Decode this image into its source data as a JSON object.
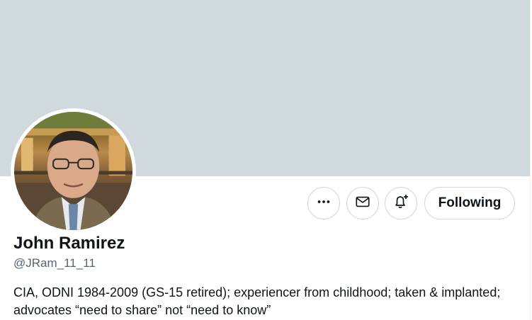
{
  "profile": {
    "display_name": "John Ramirez",
    "handle": "@JRam_11_11",
    "bio": "CIA, ODNI 1984-2009 (GS-15 retired); experiencer from childhood; taken & implanted; advocates “need to share” not “need to know”"
  },
  "actions": {
    "more_icon": "more-dots-icon",
    "message_icon": "envelope-icon",
    "notify_icon": "bell-plus-icon",
    "following_label": "Following"
  },
  "colors": {
    "banner": "#cfd9de",
    "text": "#0f1419",
    "secondary_text": "#536471",
    "border": "#cfd9de"
  }
}
